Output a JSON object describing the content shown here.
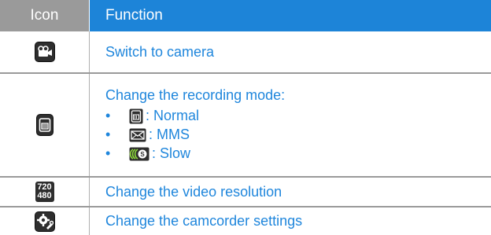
{
  "header": {
    "icon_label": "Icon",
    "function_label": "Function"
  },
  "rows": [
    {
      "icon": "camera-switch-icon",
      "text": "Switch to camera"
    },
    {
      "icon": "recording-mode-icon",
      "text": "Change the recording mode:",
      "modes": [
        {
          "icon": "normal-mode-icon",
          "label": ": Normal"
        },
        {
          "icon": "mms-mode-icon",
          "label": ": MMS"
        },
        {
          "icon": "slow-mode-icon",
          "label": ": Slow"
        }
      ]
    },
    {
      "icon": "resolution-icon",
      "res_top": "720",
      "res_bottom": "480",
      "text": "Change the video resolution"
    },
    {
      "icon": "settings-icon",
      "text": "Change the camcorder settings"
    }
  ],
  "bullet_char": "•",
  "colors": {
    "header_icon_bg": "#9a9a9a",
    "header_function_bg": "#1d84d8",
    "text_blue": "#1f86dc"
  }
}
